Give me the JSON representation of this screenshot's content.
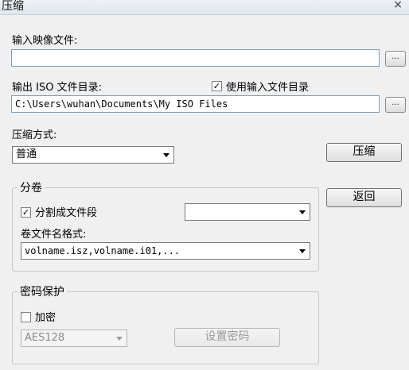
{
  "window": {
    "title": "压缩",
    "close_glyph": "×"
  },
  "input_image": {
    "label": "输入映像文件:",
    "value": "",
    "browse_label": "..."
  },
  "output_dir": {
    "label": "输出 ISO 文件目录:",
    "use_input_dir_label": "使用输入文件目录",
    "use_input_dir_checked": true,
    "value": "C:\\Users\\wuhan\\Documents\\My ISO Files",
    "browse_label": "..."
  },
  "compression": {
    "label": "压缩方式:",
    "selected": "普通"
  },
  "buttons": {
    "compress": "压缩",
    "back": "返回"
  },
  "split": {
    "group_label": "分卷",
    "split_label": "分割成文件段",
    "split_checked": true,
    "size_value": "",
    "name_format_label": "卷文件名格式:",
    "name_format_value": "volname.isz,volname.i01,..."
  },
  "password": {
    "group_label": "密码保护",
    "encrypt_label": "加密",
    "encrypt_checked": false,
    "algorithm": "AES128",
    "set_password_label": "设置密码"
  },
  "icons": {
    "check": "✓"
  }
}
